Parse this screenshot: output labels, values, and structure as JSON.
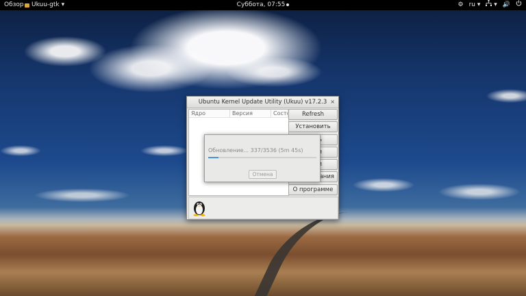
{
  "topbar": {
    "activities": "Обзор",
    "app_menu": "Ukuu-gtk",
    "app_menu_arrow": "▾",
    "clock": "Суббота, 07:55",
    "language": "ru",
    "language_arrow": "▾",
    "network_arrow": "▾",
    "icons": [
      "accessibility-icon",
      "network-icon",
      "volume-icon",
      "power-icon"
    ]
  },
  "window": {
    "title": "Ubuntu Kernel Update Utility (Ukuu) v17.2.3",
    "close": "×",
    "columns": [
      "Ядро",
      "Версия",
      "Состо"
    ],
    "buttons": [
      "Refresh",
      "Установить",
      "ить",
      "ия",
      "ки",
      "ания",
      "О программе"
    ]
  },
  "dialog": {
    "message": "Обновление... 337/3536 (5m 45s)",
    "progress_fraction": 0.095,
    "cancel": "Отмена"
  }
}
